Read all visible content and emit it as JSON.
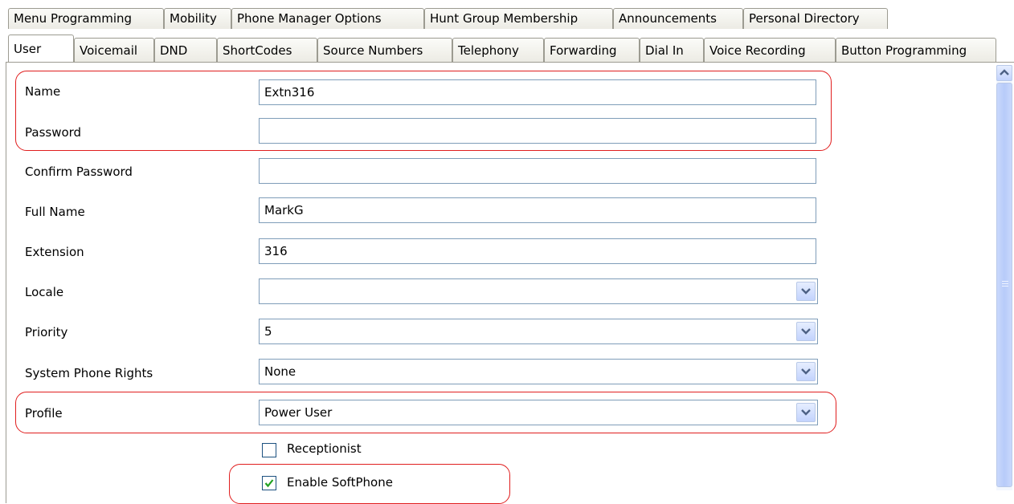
{
  "tabs_row1": [
    "Menu Programming",
    "Mobility",
    "Phone Manager Options",
    "Hunt Group Membership",
    "Announcements",
    "Personal Directory"
  ],
  "tabs_row2": [
    "User",
    "Voicemail",
    "DND",
    "ShortCodes",
    "Source Numbers",
    "Telephony",
    "Forwarding",
    "Dial In",
    "Voice Recording",
    "Button Programming"
  ],
  "active_tab": "User",
  "form": {
    "name": {
      "label": "Name",
      "value": "Extn316"
    },
    "password": {
      "label": "Password",
      "value": ""
    },
    "confirm_password": {
      "label": "Confirm Password",
      "value": ""
    },
    "full_name": {
      "label": "Full Name",
      "value": "MarkG"
    },
    "extension": {
      "label": "Extension",
      "value": "316"
    },
    "locale": {
      "label": "Locale",
      "value": ""
    },
    "priority": {
      "label": "Priority",
      "value": "5"
    },
    "system_phone_rights": {
      "label": "System Phone Rights",
      "value": "None"
    },
    "profile": {
      "label": "Profile",
      "value": "Power User"
    },
    "receptionist": {
      "label": "Receptionist",
      "checked": false
    },
    "enable_softphone": {
      "label": "Enable SoftPhone",
      "checked": true
    }
  },
  "colors": {
    "highlight": "#e01e1e",
    "field_border": "#7f9db9",
    "scroll_blue": "#c3d3fd"
  }
}
